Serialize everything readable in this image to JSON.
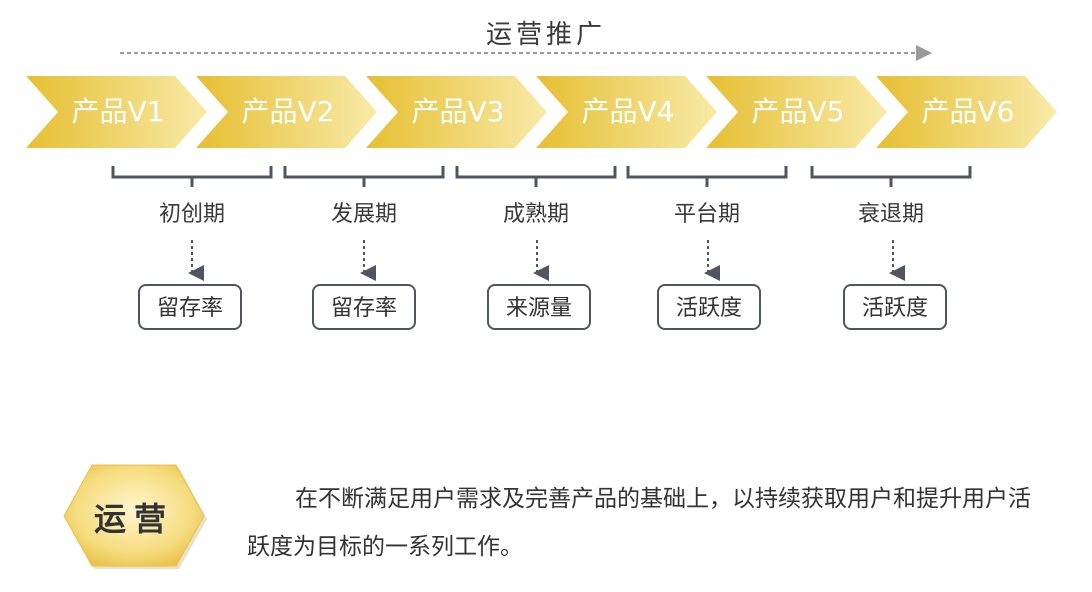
{
  "top_label": "运营推广",
  "versions": [
    "产品V1",
    "产品V2",
    "产品V3",
    "产品V4",
    "产品V5",
    "产品V6"
  ],
  "stages": [
    {
      "name": "初创期",
      "metric": "留存率"
    },
    {
      "name": "发展期",
      "metric": "留存率"
    },
    {
      "name": "成熟期",
      "metric": "来源量"
    },
    {
      "name": "平台期",
      "metric": "活跃度"
    },
    {
      "name": "衰退期",
      "metric": "活跃度"
    }
  ],
  "badge": "运营",
  "description": "在不断满足用户需求及完善产品的基础上，以持续获取用户和提升用户活跃度为目标的一系列工作。",
  "colors": {
    "chevron_dark": "#e8c43a",
    "chevron_light": "#f7e8a4",
    "bracket": "#4f5561",
    "arrow_dash": "#9a9a9a",
    "hex_fill": "#f5d76e"
  }
}
